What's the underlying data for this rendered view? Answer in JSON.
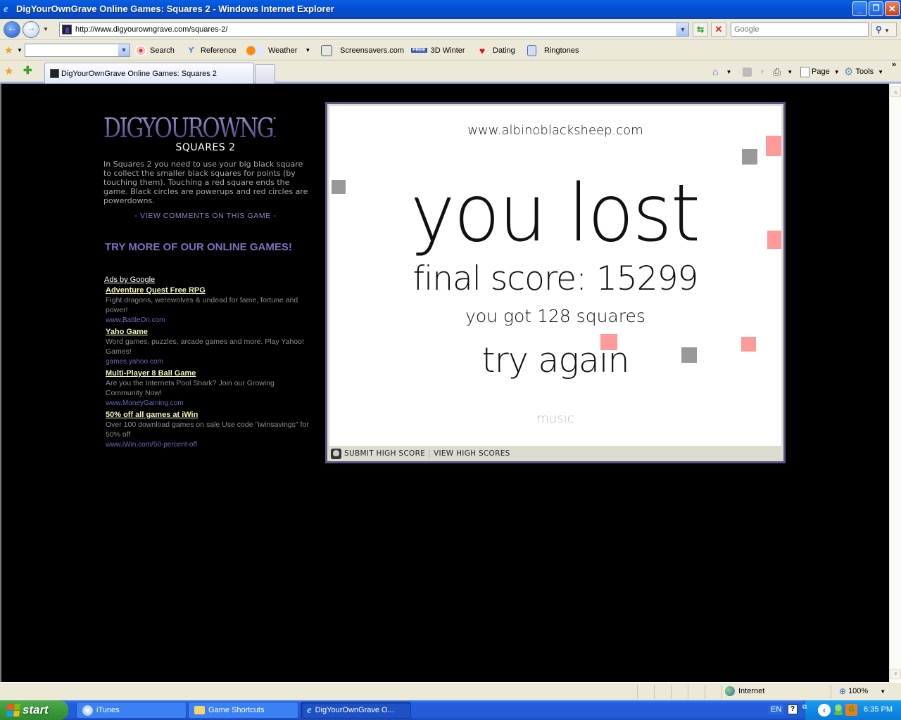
{
  "window": {
    "title": "DigYourOwnGrave Online Games: Squares 2 - Windows Internet Explorer",
    "minimize": "_",
    "restore": "❐",
    "close": "✕"
  },
  "address_bar": {
    "url": "http://www.digyourowngrave.com/squares-2/",
    "search_placeholder": "Google"
  },
  "links_toolbar": {
    "items": [
      {
        "label": "Search",
        "icon": "search-target-icon"
      },
      {
        "label": "Reference",
        "icon": "reference-icon"
      },
      {
        "label": "Weather",
        "icon": "weather-icon"
      },
      {
        "label": "Screensavers.com",
        "icon": "screensavers-icon"
      },
      {
        "label": "3D Winter",
        "icon": "free-badge-icon",
        "badge": "FREE"
      },
      {
        "label": "Dating",
        "icon": "hearts-icon"
      },
      {
        "label": "Ringtones",
        "icon": "phone-icon"
      }
    ]
  },
  "tabs": {
    "active_label": "DigYourOwnGrave Online Games: Squares 2"
  },
  "command_bar": {
    "page_label": "Page",
    "tools_label": "Tools",
    "more": "»"
  },
  "page": {
    "logo": "DIGYOUROWNGRAVE",
    "game_title": "SQUARES 2",
    "description": "In Squares 2 you need to use your big black square to collect the smaller black squares for points (by touching them). Touching a red square ends the game. Black circles are powerups and red circles are powerdowns.",
    "view_comments": "- VIEW COMMENTS ON THIS GAME -",
    "try_more": "TRY MORE OF OUR ONLINE GAMES!",
    "ads_header": "Ads by Google",
    "ads": [
      {
        "title": "Adventure Quest Free RPG",
        "desc": "Fight dragons, werewolves & undead for fame, fortune and power!",
        "url": "www.BattleOn.com"
      },
      {
        "title": "Yaho Game",
        "desc": "Word games, puzzles, arcade games and more. Play Yahoo! Games!",
        "url": "games.yahoo.com"
      },
      {
        "title": "Multi-Player 8 Ball Game",
        "desc": "Are you the Internets Pool Shark? Join our Growing Community Now!",
        "url": "www.MoneyGaming.com"
      },
      {
        "title": "50% off all games at iWin",
        "desc": "Over 100 download games on sale Use code \"iwinsavings\" for 50% off",
        "url": "www.iWin.com/50-percent-off"
      }
    ]
  },
  "game": {
    "site": "www.albinoblacksheep.com",
    "result": "you lost",
    "final_score_label": "final score:",
    "final_score": "15299",
    "squares_text": "you got 128 squares",
    "try_again": "try again",
    "music": "music",
    "submit_high_score": "SUBMIT HIGH SCORE",
    "view_high_scores": "VIEW HIGH SCORES",
    "separator": "|",
    "colors": {
      "gray_square": "#999999",
      "red_square": "#ff9a9a",
      "frame": "#5c5488"
    }
  },
  "status_bar": {
    "zone": "Internet",
    "zoom": "100%"
  },
  "taskbar": {
    "start": "start",
    "tasks": [
      {
        "label": "iTunes",
        "active": false
      },
      {
        "label": "Game Shortcuts",
        "active": false
      },
      {
        "label": "DigYourOwnGrave O...",
        "active": true
      }
    ],
    "language": "EN",
    "clock": "6:35 PM"
  }
}
